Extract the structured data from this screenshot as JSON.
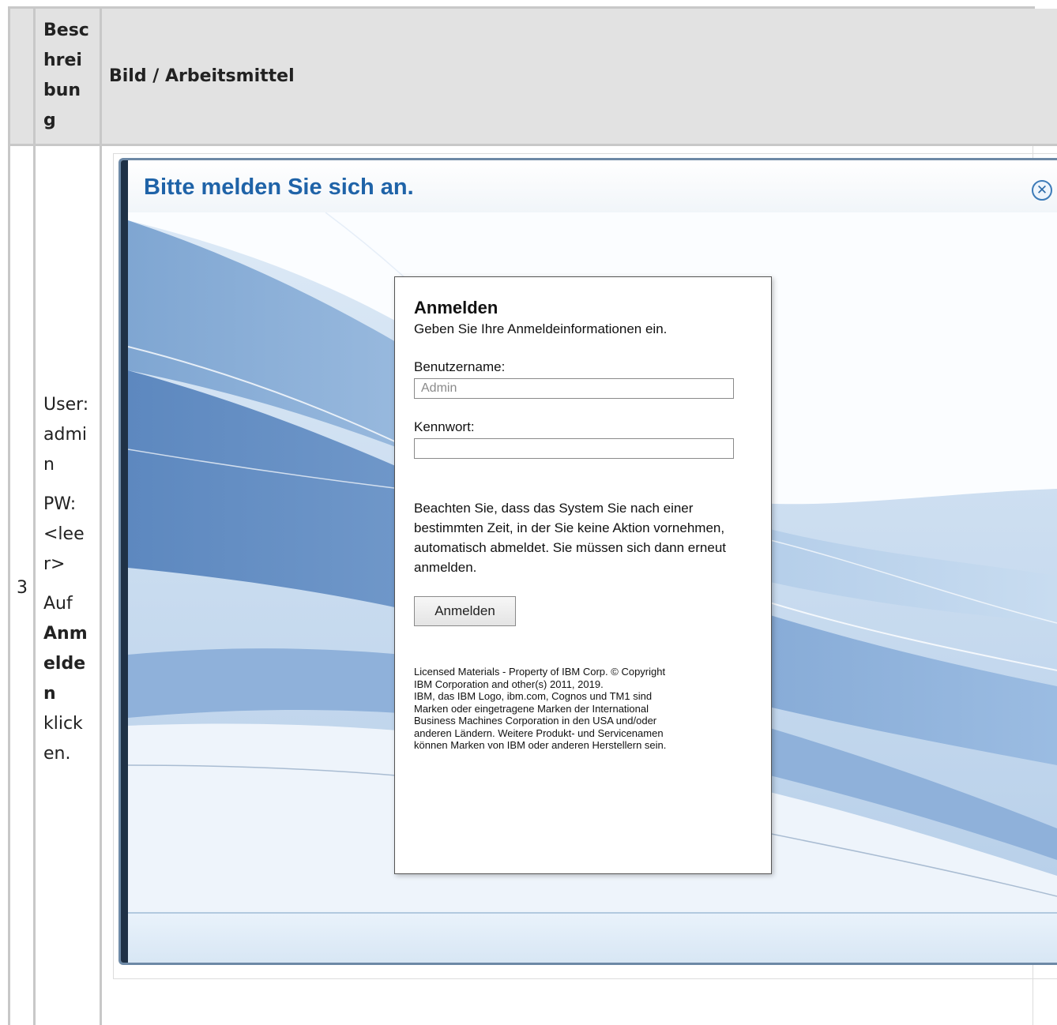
{
  "table": {
    "headers": [
      "",
      "Besc\nhrei\nbun\ng",
      "Bild / Arbeitsmittel"
    ],
    "header_col2_lines": [
      "Besc",
      "hrei",
      "bun",
      "g"
    ],
    "header_col3": "Bild / Arbeitsmittel",
    "row": {
      "number": "3",
      "user_lines": [
        "User:",
        "admi",
        "n"
      ],
      "pw_lines": [
        "PW:",
        "<lee",
        "r>"
      ],
      "action_lines": [
        "Auf",
        "Anm",
        "elde",
        "n",
        "klick",
        "en."
      ]
    }
  },
  "dialog": {
    "title": "Bitte melden Sie sich an.",
    "close_glyph": "✕"
  },
  "login": {
    "title": "Anmelden",
    "subtitle": "Geben Sie Ihre Anmeldeinformationen ein.",
    "username_label": "Benutzername:",
    "username_value": "Admin",
    "password_label": "Kennwort:",
    "password_value": "",
    "note": "Beachten Sie, dass das System Sie nach einer bestimmten Zeit, in der Sie keine Aktion vornehmen, automatisch abmeldet. Sie müssen sich dann erneut anmelden.",
    "button_label": "Anmelden",
    "legal_lines": [
      "Licensed Materials - Property of IBM Corp. © Copyright",
      "IBM Corporation and other(s) 2011, 2019.",
      "IBM, das IBM Logo, ibm.com, Cognos und TM1 sind",
      "Marken oder eingetragene Marken der International",
      "Business Machines Corporation in den USA und/oder",
      "anderen Ländern. Weitere Produkt- und Servicenamen",
      "können Marken von IBM oder anderen Herstellern sein."
    ]
  },
  "colors": {
    "title_blue": "#1f63a8",
    "header_gray": "#e2e2e2",
    "border_gray": "#c8c8c8"
  }
}
